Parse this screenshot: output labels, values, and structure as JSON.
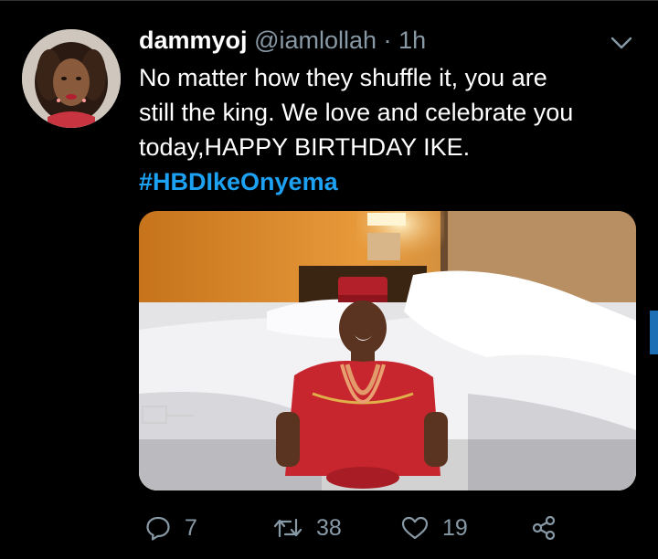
{
  "tweet": {
    "display_name": "dammyoj",
    "handle": "@iamlollah",
    "separator": "·",
    "timestamp": "1h",
    "text_lines": [
      "No matter how they shuffle it, you are",
      "still the king. We love and celebrate you",
      "today,HAPPY BIRTHDAY IKE."
    ],
    "hashtag": "#HBDIkeOnyema"
  },
  "actions": {
    "reply_count": "7",
    "retweet_count": "38",
    "like_count": "19"
  },
  "icons": {
    "menu": "chevron-down-icon",
    "reply": "reply-icon",
    "retweet": "retweet-icon",
    "like": "heart-icon",
    "share": "share-icon"
  },
  "colors": {
    "background": "#000000",
    "text": "#ffffff",
    "secondary_text": "#8899a6",
    "link": "#1da1f2"
  }
}
